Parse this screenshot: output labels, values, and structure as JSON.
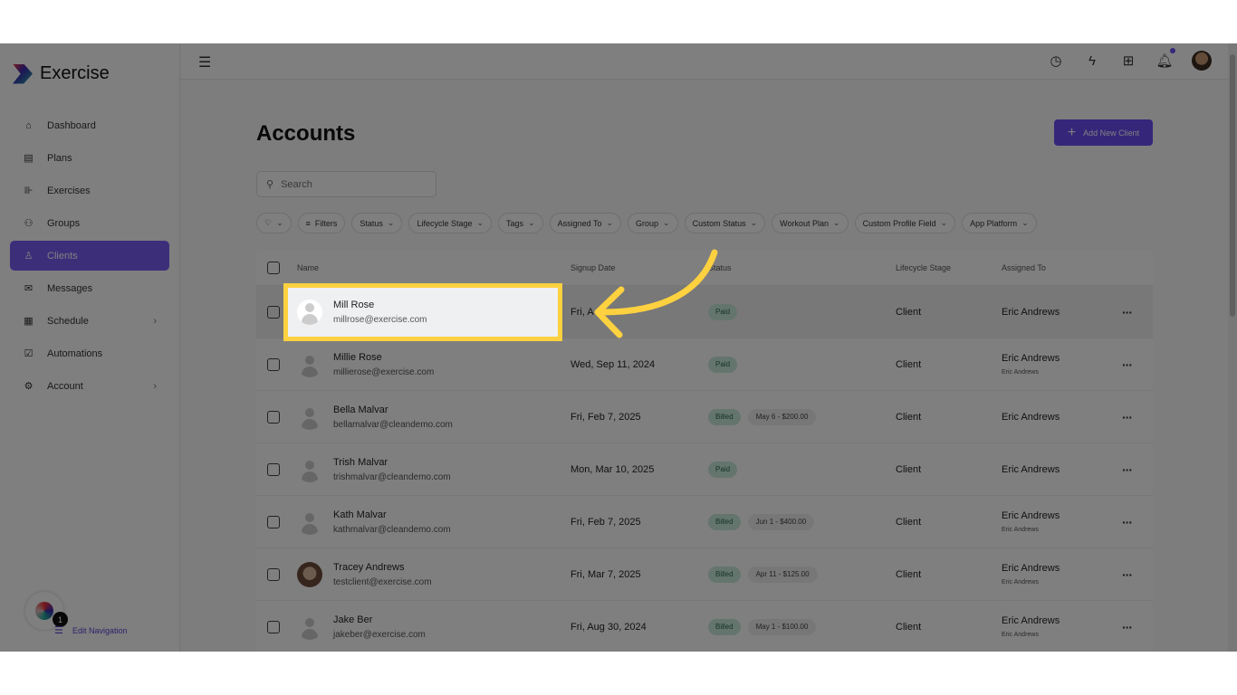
{
  "app": {
    "name": "Exercise"
  },
  "sidebar": {
    "items": [
      {
        "label": "Dashboard",
        "icon": "home-icon"
      },
      {
        "label": "Plans",
        "icon": "clipboard-icon"
      },
      {
        "label": "Exercises",
        "icon": "dumbbell-icon"
      },
      {
        "label": "Groups",
        "icon": "users-icon"
      },
      {
        "label": "Clients",
        "icon": "user-icon",
        "active": true
      },
      {
        "label": "Messages",
        "icon": "mail-icon"
      },
      {
        "label": "Schedule",
        "icon": "calendar-icon",
        "chevron": true
      },
      {
        "label": "Automations",
        "icon": "checkbox-icon"
      },
      {
        "label": "Account",
        "icon": "gear-icon",
        "chevron": true
      }
    ],
    "edit_nav": "Edit Navigation",
    "badge": "1"
  },
  "page": {
    "title": "Accounts",
    "add_button": "Add New Client",
    "search_placeholder": "Search"
  },
  "filters": [
    "Filters",
    "Status",
    "Lifecycle Stage",
    "Tags",
    "Assigned To",
    "Group",
    "Custom Status",
    "Workout Plan",
    "Custom Profile Field",
    "App Platform"
  ],
  "table": {
    "headers": [
      "Name",
      "Signup Date",
      "Status",
      "Lifecycle Stage",
      "Assigned To"
    ],
    "rows": [
      {
        "name": "Mill Rose",
        "email": "millrose@exercise.com",
        "date": "Fri, A",
        "status": "Paid",
        "extra": "",
        "stage": "Client",
        "assigned": "Eric Andrews",
        "sub": ""
      },
      {
        "name": "Millie Rose",
        "email": "millierose@exercise.com",
        "date": "Wed, Sep 11, 2024",
        "status": "Paid",
        "extra": "",
        "stage": "Client",
        "assigned": "Eric Andrews",
        "sub": "Eric Andrews"
      },
      {
        "name": "Bella Malvar",
        "email": "bellamalvar@cleandemo.com",
        "date": "Fri, Feb 7, 2025",
        "status": "Billed",
        "extra": "May 6 - $200.00",
        "stage": "Client",
        "assigned": "Eric Andrews",
        "sub": ""
      },
      {
        "name": "Trish Malvar",
        "email": "trishmalvar@cleandemo.com",
        "date": "Mon, Mar 10, 2025",
        "status": "Paid",
        "extra": "",
        "stage": "Client",
        "assigned": "Eric Andrews",
        "sub": ""
      },
      {
        "name": "Kath Malvar",
        "email": "kathmalvar@cleandemo.com",
        "date": "Fri, Feb 7, 2025",
        "status": "Billed",
        "extra": "Jun 1 - $400.00",
        "stage": "Client",
        "assigned": "Eric Andrews",
        "sub": "Eric Andrews"
      },
      {
        "name": "Tracey Andrews",
        "email": "testclient@exercise.com",
        "date": "Fri, Mar 7, 2025",
        "status": "Billed",
        "extra": "Apr 11 - $125.00",
        "stage": "Client",
        "assigned": "Eric Andrews",
        "sub": "Eric Andrews",
        "photo": true
      },
      {
        "name": "Jake Ber",
        "email": "jakeber@exercise.com",
        "date": "Fri, Aug 30, 2024",
        "status": "Billed",
        "extra": "May 1 - $100.00",
        "stage": "Client",
        "assigned": "Eric Andrews",
        "sub": "Eric Andrews"
      }
    ]
  },
  "colors": {
    "accent": "#6c4df5",
    "highlight": "#fdd13f"
  }
}
